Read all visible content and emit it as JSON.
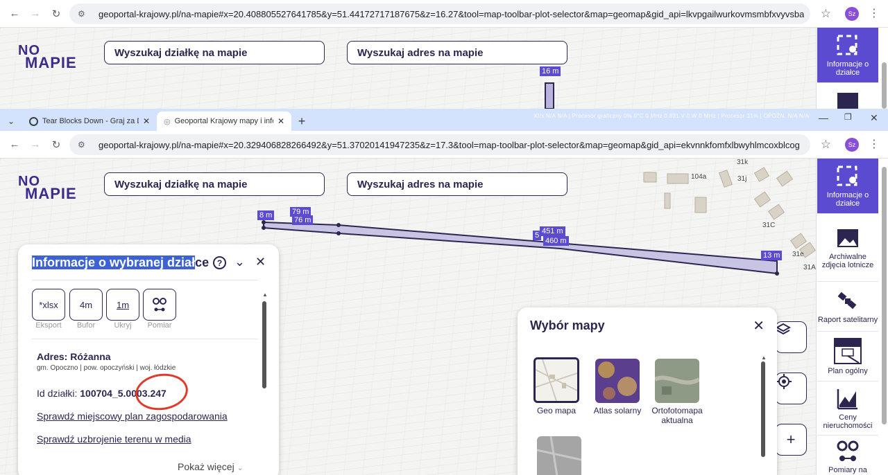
{
  "browser_top": {
    "url": "geoportal-krajowy.pl/na-mapie#x=20.408805527641785&y=51.44172717187675&z=16.27&tool=map-toolbar-plot-selector&map=geomap&gid_api=lkvpgailwurkovmsmbfxvyvsba",
    "profile": "Sz"
  },
  "browser_bottom": {
    "url": "geoportal-krajowy.pl/na-mapie#x=20.329406828266492&y=51.37020141947235&z=17.3&tool=map-toolbar-plot-selector&map=geomap&gid_api=ekvnnkfomfxlbwyhlmcoxblcog",
    "profile": "Sz"
  },
  "tabs": [
    {
      "title": "Tear Blocks Down - Graj za Darmo"
    },
    {
      "title": "Geoportal Krajowy mapy i informacje"
    }
  ],
  "stats_text": "Kl/s  N/A  N/A  |  Procesor graficzny  0%  0°C 0 MHz  0.831 V  0 W  0 MHz  |  Procesor  31%  |  OPÓŹN.  N/A  N/A",
  "logo": {
    "line1": "NO",
    "line2": "MAPIE"
  },
  "search": {
    "parcel": "Wyszukaj działkę na mapie",
    "address": "Wyszukaj adres na mapie"
  },
  "measure_top": {
    "label": "16 m"
  },
  "measures": {
    "left": "8 m",
    "upper_a": "79 m",
    "upper_b": "76 m",
    "mid_prefix": "5",
    "mid_a": "451 m",
    "mid_b": "460 m",
    "right": "13 m"
  },
  "parcel_numbers": [
    "104a",
    "31j",
    "31C",
    "31e",
    "31A",
    "31k"
  ],
  "sidebar": {
    "items": [
      {
        "label": "Informacje o działce"
      },
      {
        "label": "Archiwalne zdjęcia lotnicze"
      },
      {
        "label": "Raport satelitarny"
      },
      {
        "label": "Plan ogólny"
      },
      {
        "label": "Ceny nieruchomości"
      },
      {
        "label": "Pomiary na"
      }
    ],
    "plan_icon": {
      "top": "SO",
      "mid": "SK"
    }
  },
  "panel": {
    "title_highlighted": "Informacje o wybranej dział",
    "title_rest": "ce",
    "help": "?",
    "tools": [
      {
        "icon": "*xlsx",
        "label": "Eksport"
      },
      {
        "icon": "4m",
        "label": "Bufor"
      },
      {
        "icon": "1m",
        "label": "Ukryj"
      },
      {
        "icon": "measure",
        "label": "Pomiar"
      }
    ],
    "address": "Adres: Różanna",
    "gmina": "gm. Opoczno | pow. opoczyński | woj. łódzkie",
    "id_label": "Id działki: ",
    "id_value": "100704_5.0003.247",
    "link_plan": "Sprawdź miejscowy plan zagospodarowania",
    "link_media": "Sprawdź uzbrojenie terenu w media",
    "more": "Pokaż więcej"
  },
  "chooser": {
    "title": "Wybór mapy",
    "maps": [
      {
        "label": "Geo mapa"
      },
      {
        "label": "Atlas solarny"
      },
      {
        "label": "Ortofotomapa aktualna"
      }
    ]
  },
  "colors": {
    "accent": "#5b4bd1",
    "dark": "#2c2550",
    "annotation": "#e23a2a"
  }
}
